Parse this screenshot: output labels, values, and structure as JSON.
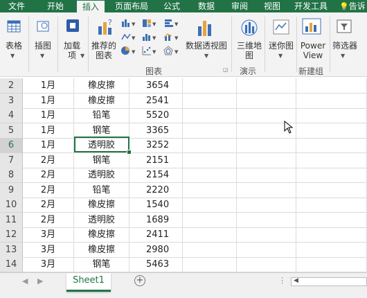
{
  "ribbon_tabs": [
    "文件",
    "开始",
    "插入",
    "页面布局",
    "公式",
    "数据",
    "审阅",
    "视图",
    "开发工具",
    "告诉"
  ],
  "ribbon": {
    "table": "表格",
    "illustrations": "插图",
    "addins": "加载项",
    "recommended_charts": "推荐的图表",
    "pivot_chart": "数据透视图",
    "map3d": "三维地图",
    "sparkline": "迷你图",
    "powerview": "Power View",
    "filter": "筛选器",
    "group_charts": "图表",
    "group_tours": "演示",
    "group_new": "新建组"
  },
  "rows": [
    {
      "n": "2",
      "month": "1月",
      "item": "橡皮擦",
      "qty": "3654"
    },
    {
      "n": "3",
      "month": "1月",
      "item": "橡皮擦",
      "qty": "2541"
    },
    {
      "n": "4",
      "month": "1月",
      "item": "铅笔",
      "qty": "5520"
    },
    {
      "n": "5",
      "month": "1月",
      "item": "钢笔",
      "qty": "3365"
    },
    {
      "n": "6",
      "month": "1月",
      "item": "透明胶",
      "qty": "3252"
    },
    {
      "n": "7",
      "month": "2月",
      "item": "钢笔",
      "qty": "2151"
    },
    {
      "n": "8",
      "month": "2月",
      "item": "透明胶",
      "qty": "2154"
    },
    {
      "n": "9",
      "month": "2月",
      "item": "铅笔",
      "qty": "2220"
    },
    {
      "n": "10",
      "month": "2月",
      "item": "橡皮擦",
      "qty": "1540"
    },
    {
      "n": "11",
      "month": "2月",
      "item": "透明胶",
      "qty": "1689"
    },
    {
      "n": "12",
      "month": "3月",
      "item": "橡皮擦",
      "qty": "2411"
    },
    {
      "n": "13",
      "month": "3月",
      "item": "橡皮擦",
      "qty": "2980"
    },
    {
      "n": "14",
      "month": "3月",
      "item": "钢笔",
      "qty": "5463"
    }
  ],
  "sheet_tab": "Sheet1",
  "colors": {
    "accent": "#217346"
  }
}
